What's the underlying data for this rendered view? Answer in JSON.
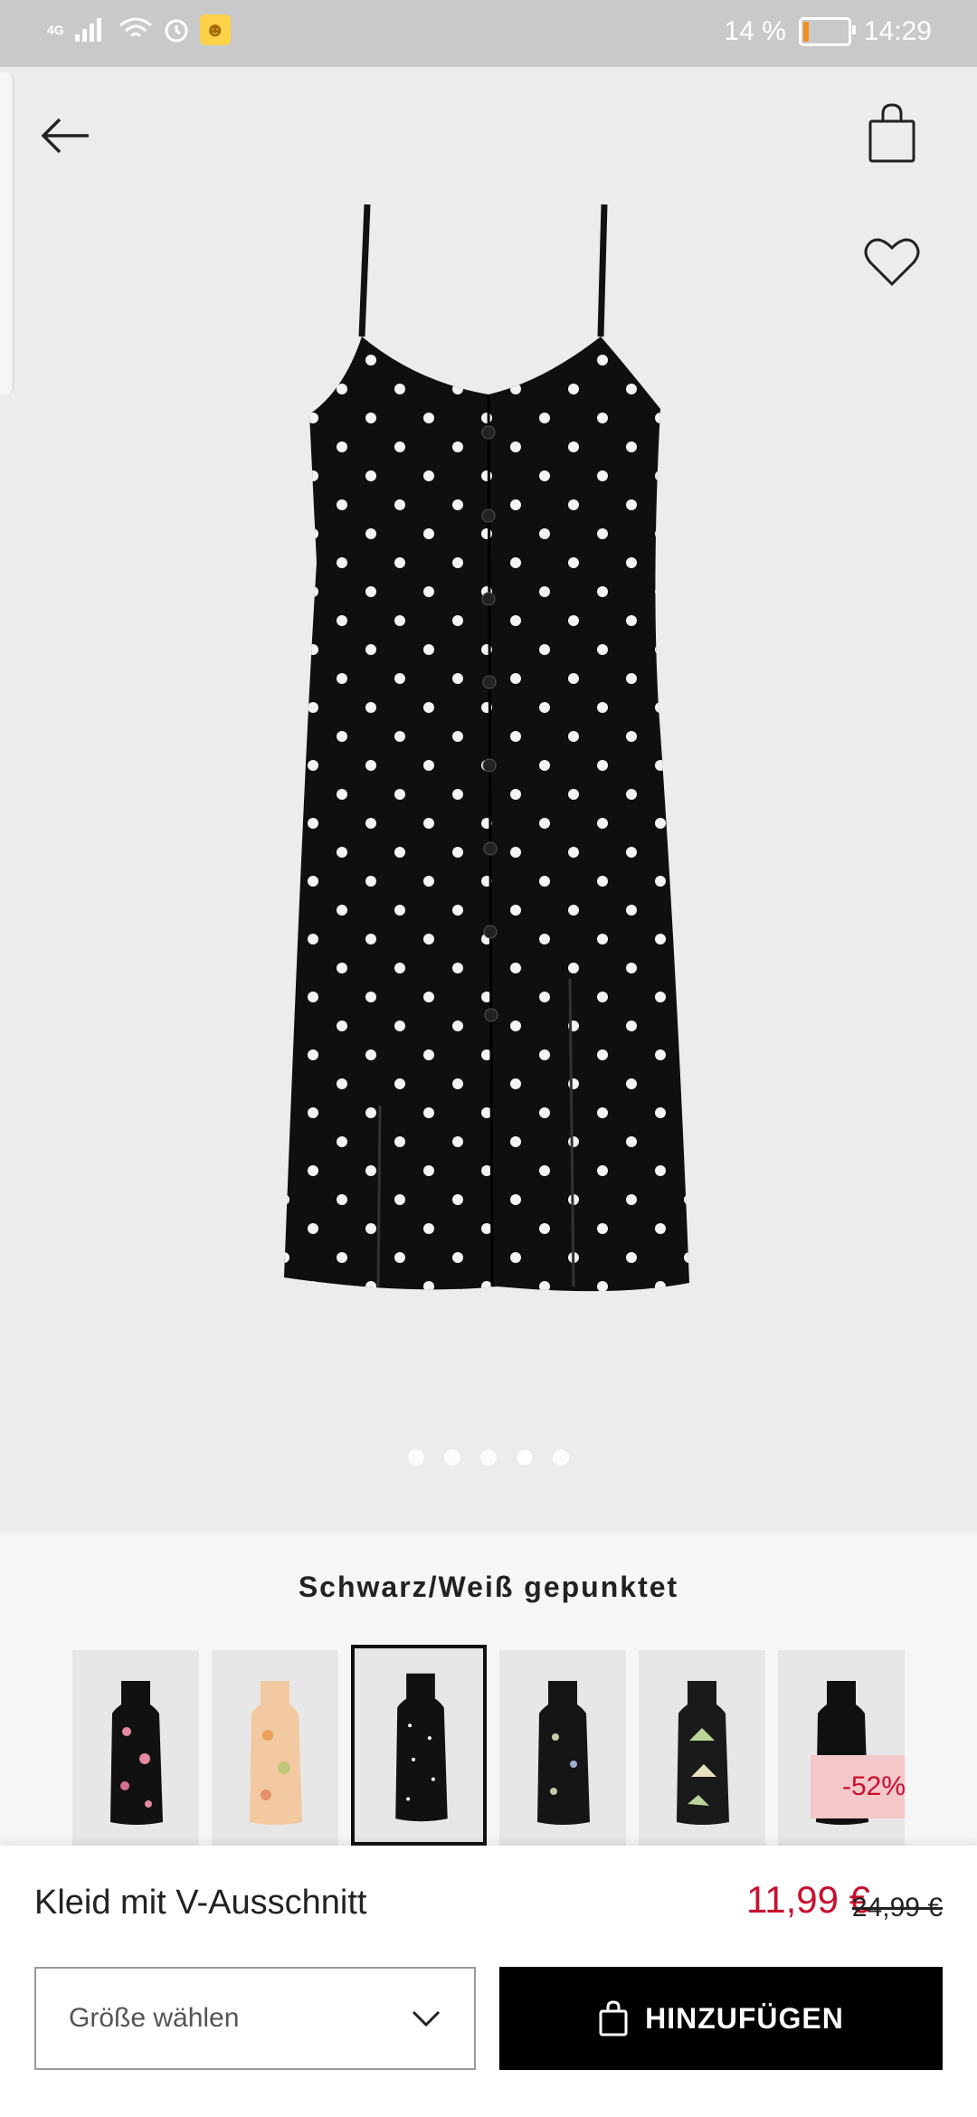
{
  "status_bar": {
    "network": "4G",
    "battery": "14 %",
    "battery_level": 0.14,
    "time": "14:29"
  },
  "gallery": {
    "total_images": 5,
    "active_index": 3
  },
  "color_section": {
    "selected_color_name": "Schwarz/Weiß gepunktet",
    "thumbnails": [
      {
        "style": "black-floral"
      },
      {
        "style": "peach-floral"
      },
      {
        "style": "black-white-dots",
        "selected": true
      },
      {
        "style": "black-flower-print"
      },
      {
        "style": "black-palm-print"
      },
      {
        "style": "black-plain",
        "badge": "-52%"
      }
    ]
  },
  "product": {
    "name": "Kleid mit V-Ausschnitt",
    "price_current": "11,99 €",
    "price_original": "24,99 €"
  },
  "actions": {
    "size_placeholder": "Größe wählen",
    "add_button_label": "HINZUFÜGEN"
  },
  "colors": {
    "sale_red": "#c8102e",
    "battery_orange": "#f28c1b"
  }
}
